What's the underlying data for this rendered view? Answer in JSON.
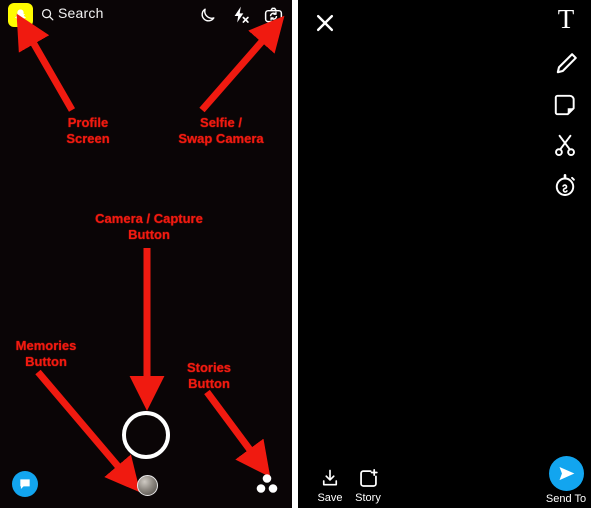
{
  "meta": {
    "title": "Snapchat camera screen and snap editor annotated diagram",
    "annotation_color": "#f01a10",
    "brand_yellow": "#FFFC00",
    "brand_blue": "#12a5ef",
    "background": "#000000"
  },
  "camera_panel": {
    "topbar": {
      "profile_icon": "snapchat-ghost-icon",
      "search_icon": "search-icon",
      "search_label": "Search",
      "night_mode_icon": "moon-icon",
      "flash_icon": "flash-off-icon",
      "swap_camera_icon": "camera-flip-icon"
    },
    "annotations": [
      {
        "id": "profile",
        "text": "Profile\nScreen"
      },
      {
        "id": "selfie",
        "text": "Selfie /\nSwap Camera"
      },
      {
        "id": "capture",
        "text": "Camera / Capture\nButton"
      },
      {
        "id": "memories",
        "text": "Memories\nButton"
      },
      {
        "id": "stories",
        "text": "Stories\nButton"
      }
    ],
    "controls": {
      "capture_button": "capture-shutter-ring",
      "memories_button": "memories-thumbnail",
      "chat_button": "chat-bubble-icon",
      "stories_button": "stories-three-dots-icon"
    }
  },
  "editor_panel": {
    "close_label": "close",
    "tools": [
      {
        "id": "text",
        "glyph": "T",
        "name": "text-tool"
      },
      {
        "id": "draw",
        "glyph": "",
        "name": "pencil-draw-tool"
      },
      {
        "id": "sticker",
        "glyph": "",
        "name": "sticker-tool"
      },
      {
        "id": "scissors",
        "glyph": "",
        "name": "scissors-cutout-tool"
      },
      {
        "id": "timer",
        "glyph": "",
        "name": "timer-infinity-tool"
      }
    ],
    "bottom": {
      "save_label": "Save",
      "story_label": "Story",
      "send_label": "Send To"
    }
  }
}
